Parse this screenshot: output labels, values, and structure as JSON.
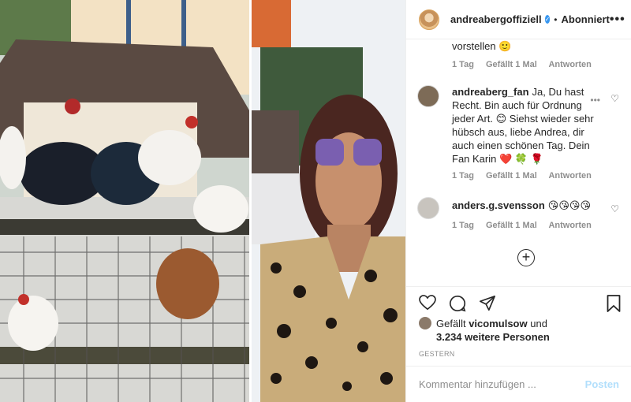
{
  "post": {
    "author": "andreabergoffiziell",
    "separator": "•",
    "follow_label": "Abonniert",
    "more_label": "•••"
  },
  "comments": {
    "cut_text": "vorstellen 🙂",
    "first_meta": {
      "time": "1 Tag",
      "likes": "Gefällt 1 Mal",
      "reply": "Antworten"
    },
    "items": [
      {
        "user": "andreaberg_fan",
        "text": "Ja, Du hast Recht. Bin auch für Ordnung jeder Art. 😊 Siehst wieder sehr hübsch aus, liebe Andrea, dir auch einen schönen Tag. Dein Fan Karin ❤️ 🍀 🌹",
        "time": "1 Tag",
        "likes": "Gefällt 1 Mal",
        "reply": "Antworten"
      },
      {
        "user": "anders.g.svensson",
        "text": "😘😘😘😘",
        "time": "1 Tag",
        "likes": "Gefällt 1 Mal",
        "reply": "Antworten"
      }
    ],
    "load_more_icon": "plus-circle-icon"
  },
  "actions": {
    "icons": [
      "heart-icon",
      "comment-icon",
      "share-icon",
      "bookmark-icon"
    ]
  },
  "likes": {
    "prefix": "Gefällt",
    "user": "vicomulsow",
    "conjunction": "und",
    "others": "3.234 weitere Personen"
  },
  "date_label": "GESTERN",
  "comment_input": {
    "placeholder": "Kommentar hinzufügen ...",
    "post_label": "Posten"
  },
  "colors": {
    "link_blue": "#3897f0",
    "post_disabled": "#b2dffc",
    "meta_gray": "#8e8e8e"
  }
}
